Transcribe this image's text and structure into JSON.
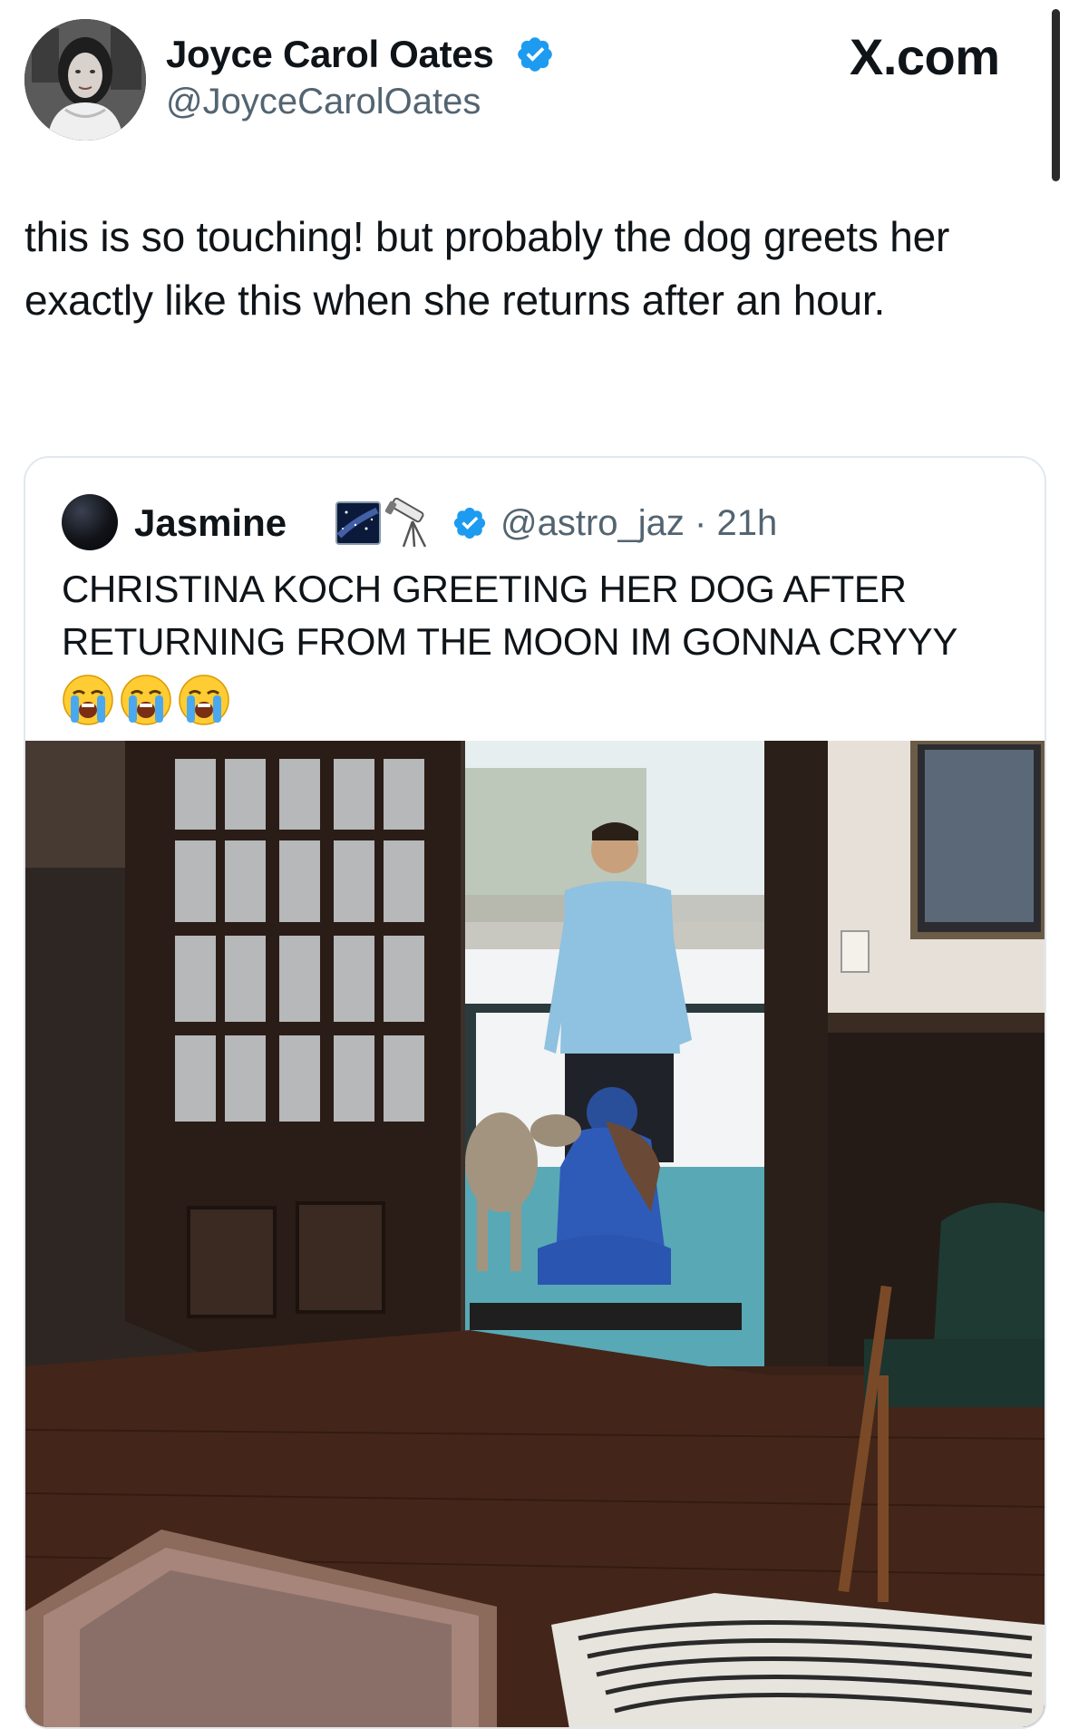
{
  "header": {
    "author_name": "Joyce Carol Oates",
    "author_handle": "@JoyceCarolOates",
    "site_label": "X.com",
    "verified_icon": "verified-badge-icon"
  },
  "tweet": {
    "text": "this is so touching! but probably the dog greets her exactly like this when she returns after an hour."
  },
  "quote": {
    "author_name": "Jasmine",
    "emojis": [
      "milky-way-emoji",
      "telescope-emoji"
    ],
    "handle_time": "@astro_jaz · 21h",
    "text": "CHRISTINA KOCH GREETING HER DOG AFTER RETURNING FROM THE MOON IM GONNA CRYYY",
    "reaction_emojis": [
      "loudly-crying-face",
      "loudly-crying-face",
      "loudly-crying-face"
    ]
  },
  "colors": {
    "verified_blue": "#1d9bf0",
    "text_primary": "#0f1419",
    "text_secondary": "#536471",
    "card_border": "#e1e8ed"
  }
}
